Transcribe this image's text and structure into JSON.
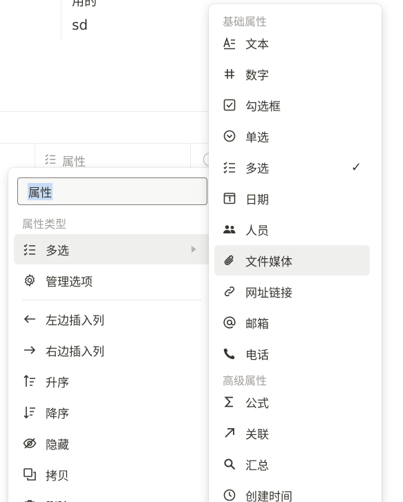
{
  "background": {
    "cut_text": "用的",
    "cell_text": "sd",
    "column_header": "属性"
  },
  "left_menu": {
    "name_input_value": "属性",
    "section_label": "属性类型",
    "type_item": "多选",
    "manage_item": "管理选项",
    "actions": [
      {
        "label": "左边插入列",
        "icon": "arrow-left-icon"
      },
      {
        "label": "右边插入列",
        "icon": "arrow-right-icon"
      },
      {
        "label": "升序",
        "icon": "sort-ascending-icon"
      },
      {
        "label": "降序",
        "icon": "sort-descending-icon"
      },
      {
        "label": "隐藏",
        "icon": "eye-off-icon"
      },
      {
        "label": "拷贝",
        "icon": "copy-icon"
      },
      {
        "label": "删除",
        "icon": "trash-icon"
      }
    ]
  },
  "right_menu": {
    "basic_label": "基础属性",
    "advanced_label": "高级属性",
    "basic_items": [
      {
        "label": "文本",
        "icon": "text-icon"
      },
      {
        "label": "数字",
        "icon": "hash-icon"
      },
      {
        "label": "勾选框",
        "icon": "checkbox-icon"
      },
      {
        "label": "单选",
        "icon": "single-select-icon"
      },
      {
        "label": "多选",
        "icon": "multi-select-icon",
        "checked": true
      },
      {
        "label": "日期",
        "icon": "calendar-icon"
      },
      {
        "label": "人员",
        "icon": "people-icon"
      },
      {
        "label": "文件媒体",
        "icon": "paperclip-icon"
      },
      {
        "label": "网址链接",
        "icon": "link-icon"
      },
      {
        "label": "邮箱",
        "icon": "at-icon"
      },
      {
        "label": "电话",
        "icon": "phone-icon"
      }
    ],
    "advanced_items": [
      {
        "label": "公式",
        "icon": "sigma-icon"
      },
      {
        "label": "关联",
        "icon": "arrow-up-right-icon"
      },
      {
        "label": "汇总",
        "icon": "search-icon"
      },
      {
        "label": "创建时间",
        "icon": "clock-icon"
      }
    ],
    "checkmark": "✓"
  }
}
